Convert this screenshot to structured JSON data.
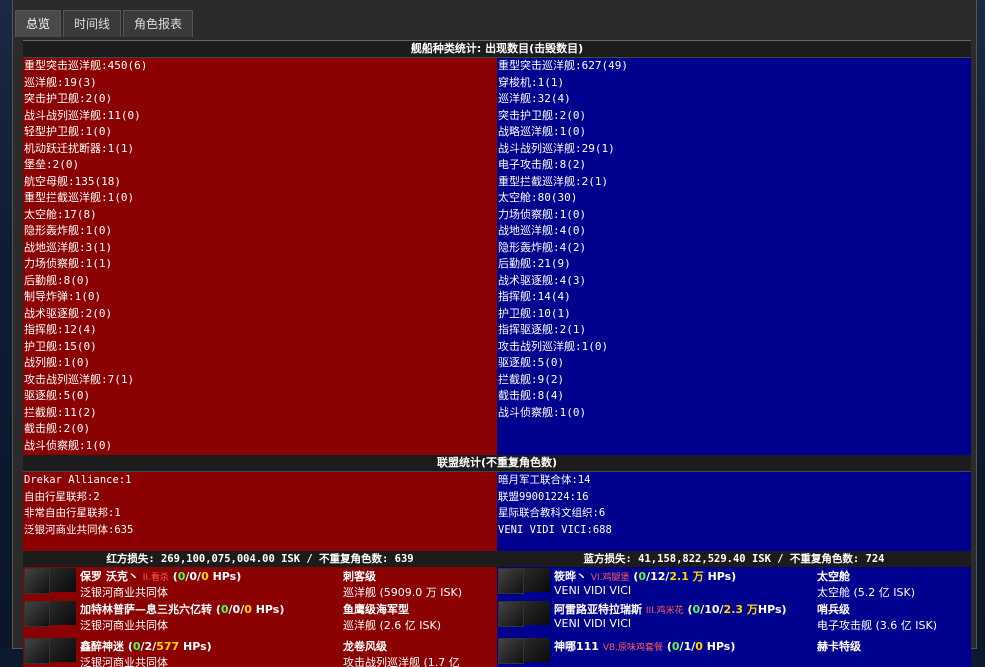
{
  "tabs": [
    "总览",
    "时间线",
    "角色报表"
  ],
  "ship_header": "舰船种类统计: 出现数目(击毁数目)",
  "red_ships": [
    "重型突击巡洋舰:450(6)",
    "巡洋舰:19(3)",
    "突击护卫舰:2(0)",
    "战斗战列巡洋舰:11(0)",
    "轻型护卫舰:1(0)",
    "机动跃迁扰断器:1(1)",
    "堡垒:2(0)",
    "航空母舰:135(18)",
    "重型拦截巡洋舰:1(0)",
    "太空舱:17(8)",
    "隐形轰炸舰:1(0)",
    "战地巡洋舰:3(1)",
    "力场侦察舰:1(1)",
    "后勤舰:8(0)",
    "制导炸弹:1(0)",
    "战术驱逐舰:2(0)",
    "指挥舰:12(4)",
    "护卫舰:15(0)",
    "战列舰:1(0)",
    "攻击战列巡洋舰:7(1)",
    "驱逐舰:5(0)",
    "拦截舰:11(2)",
    "截击舰:2(0)",
    "战斗侦察舰:1(0)"
  ],
  "blue_ships": [
    "重型突击巡洋舰:627(49)",
    "穿梭机:1(1)",
    "巡洋舰:32(4)",
    "突击护卫舰:2(0)",
    "战略巡洋舰:1(0)",
    "战斗战列巡洋舰:29(1)",
    "电子攻击舰:8(2)",
    "重型拦截巡洋舰:2(1)",
    "太空舱:80(30)",
    "力场侦察舰:1(0)",
    "战地巡洋舰:4(0)",
    "隐形轰炸舰:4(2)",
    "后勤舰:21(9)",
    "战术驱逐舰:4(3)",
    "指挥舰:14(4)",
    "护卫舰:10(1)",
    "指挥驱逐舰:2(1)",
    "攻击战列巡洋舰:1(0)",
    "驱逐舰:5(0)",
    "拦截舰:9(2)",
    "截击舰:8(4)",
    "战斗侦察舰:1(0)"
  ],
  "alliance_header": "联盟统计(不重复角色数)",
  "red_alliances": [
    "Drekar Alliance:1",
    "自由行星联邦:2",
    "非常自由行星联邦:1",
    "泛银河商业共同体:635"
  ],
  "blue_alliances": [
    "暗月军工联合体:14",
    "联盟99001224:16",
    "星际联合教科文组织:6",
    "VENI VIDI VICI:688"
  ],
  "red_loss": "红方损失: 269,100,075,004.00 ISK / 不重复角色数: 639",
  "blue_loss": "蓝方损失: 41,158,822,529.40 ISK / 不重复角色数: 724",
  "red_kills": [
    {
      "name": "保罗 沃克丶",
      "tag": "II.看杀",
      "s1": "0",
      "s2": "/0/",
      "s3": "0",
      "s4": " HPs)",
      "corp": "泛银河商业共同体",
      "ship": "刺客级",
      "value": "巡洋舰 (5909.0 万 ISK)"
    },
    {
      "name": "加特林普萨—息三兆六亿转",
      "tag": "",
      "s1": "0",
      "s2": "/0/",
      "s3": "0",
      "s4": " HPs)",
      "corp": "泛银河商业共同体",
      "ship": "鱼鹰级海军型",
      "value": "巡洋舰 (2.6 亿 ISK)"
    },
    {
      "name": "鑫醉神迷",
      "tag": "",
      "s1": "0",
      "s2": "/2/",
      "s3": "577",
      "s4": " HPs)",
      "corp": "泛银河商业共同体",
      "ship": "龙卷风级",
      "value": "攻击战列巡洋舰 (1.7 亿"
    }
  ],
  "blue_kills": [
    {
      "name": "筱晔丶",
      "tag": "VI.鸡腿堡",
      "s1": "0",
      "s2": "/12/",
      "s3": "2.1 万",
      "s4": " HPs)",
      "corp": "VENI VIDI VICI",
      "ship": "太空舱",
      "value": "太空舱 (5.2 亿 ISK)"
    },
    {
      "name": "阿雷路亚特拉瑞斯",
      "tag": "III.鸡米花",
      "s1": "0",
      "s2": "/10/",
      "s3": "2.3 万",
      "s4": "HPs)",
      "corp": "VENI VIDI VICI",
      "ship": "哨兵级",
      "value": "电子攻击舰 (3.6 亿 ISK)"
    },
    {
      "name": "神哪111",
      "tag": "VB.原味鸡套餐",
      "s1": "0",
      "s2": "/1/",
      "s3": "0",
      "s4": " HPs)",
      "corp": "",
      "ship": "赫卡特级",
      "value": ""
    }
  ]
}
